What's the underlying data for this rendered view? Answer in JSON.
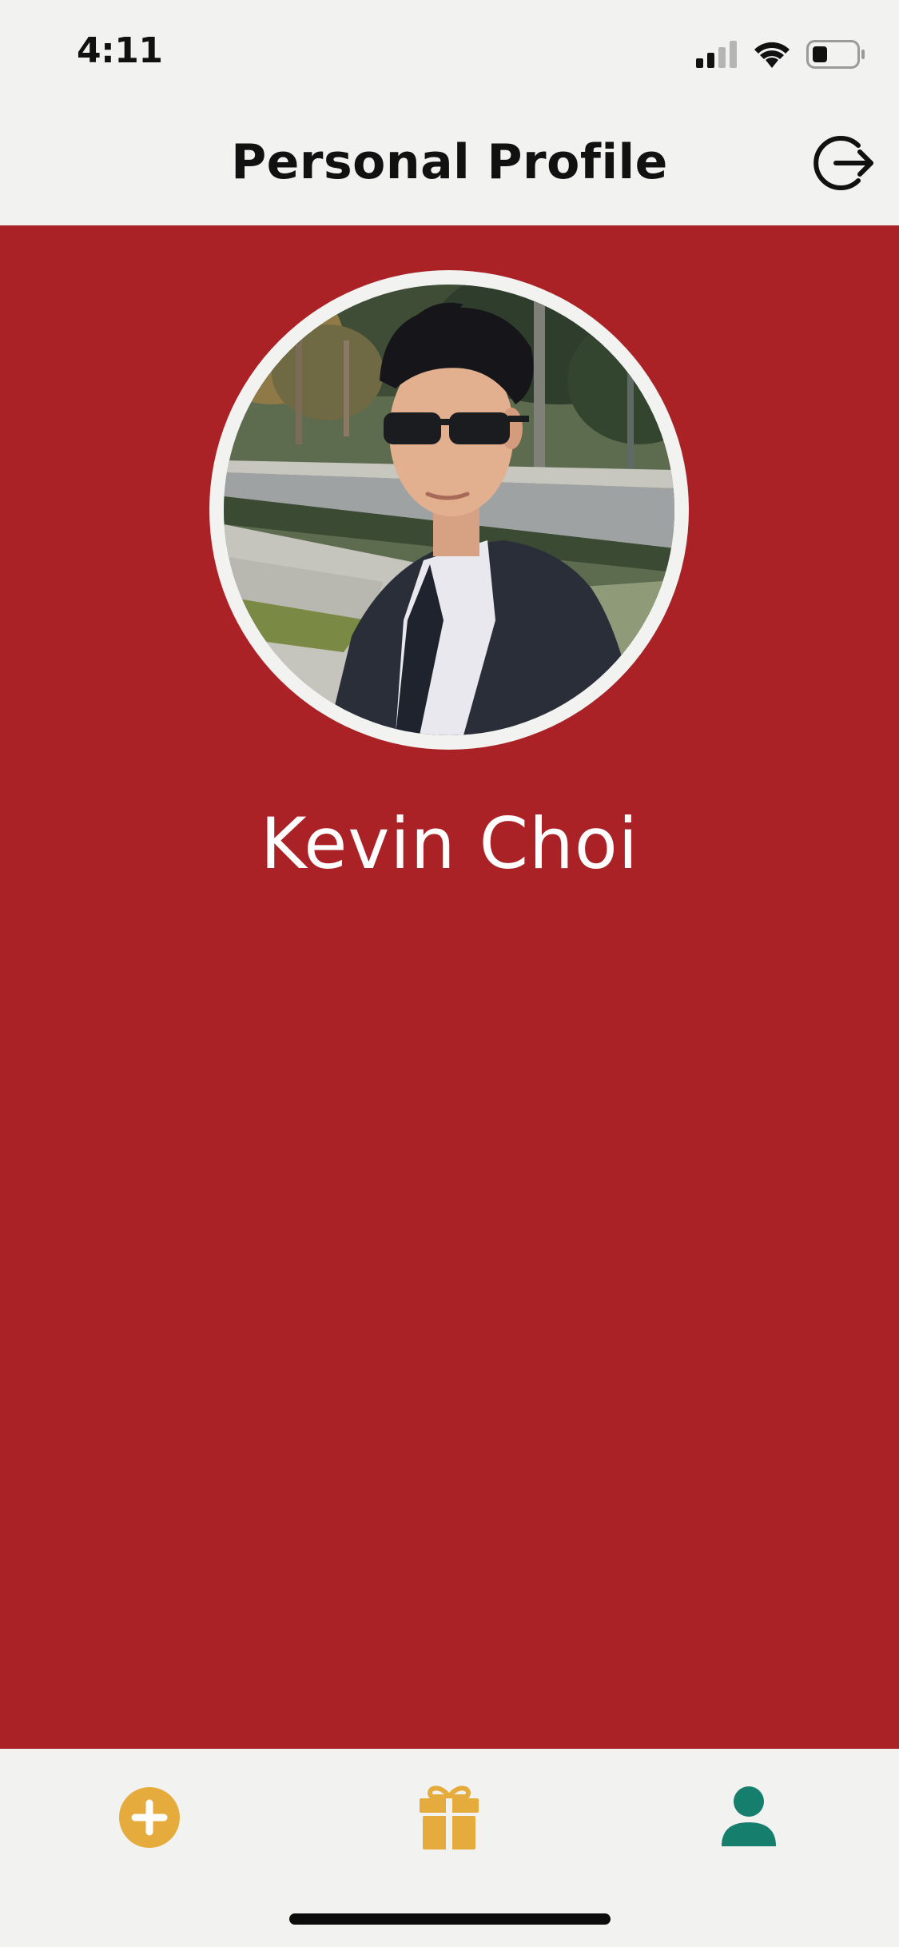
{
  "status_bar": {
    "time": "4:11",
    "icons": [
      "signal-icon",
      "wifi-icon",
      "battery-icon"
    ]
  },
  "header": {
    "title": "Personal Profile",
    "logout_icon": "logout-icon"
  },
  "profile": {
    "name": "Kevin Choi",
    "avatar_icon": "profile-photo"
  },
  "tab_bar": {
    "tabs": [
      {
        "icon": "add-icon",
        "active": false
      },
      {
        "icon": "gift-icon",
        "active": false
      },
      {
        "icon": "person-icon",
        "active": true
      }
    ]
  },
  "colors": {
    "background": "#f2f2f1",
    "panel": "#aa2226",
    "accent_gold": "#e5ac3d",
    "active_teal": "#157e6c",
    "text_dark": "#111111",
    "text_light": "#ffffff"
  }
}
